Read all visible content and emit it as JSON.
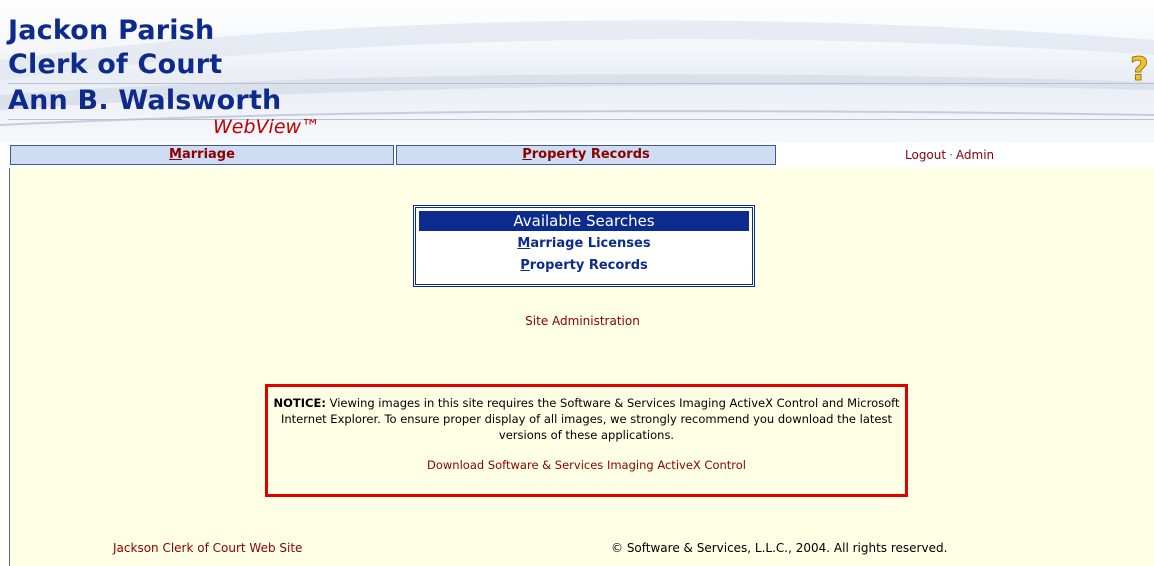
{
  "header": {
    "line1": "Jackon Parish",
    "line2": "Clerk of Court",
    "line3": "Ann B. Walsworth",
    "product": "WebView™",
    "help_icon": "question-mark-icon"
  },
  "nav": {
    "marriage_accesskey": "M",
    "marriage_rest": "arriage",
    "property_accesskey": "P",
    "property_rest": "roperty Records",
    "logout": "Logout",
    "separator": "·",
    "admin": "Admin"
  },
  "searches": {
    "title": "Available Searches",
    "marriage_accesskey": "M",
    "marriage_rest": "arriage Licenses",
    "property_accesskey": "P",
    "property_rest": "roperty Records"
  },
  "site_admin": "Site Administration",
  "notice": {
    "label": "NOTICE:",
    "text": "Viewing images in this site requires the Software & Services Imaging ActiveX Control and Microsoft Internet Explorer. To ensure proper display of all images, we strongly recommend you download the latest versions of these applications.",
    "download_link": "Download Software & Services Imaging ActiveX Control"
  },
  "footer": {
    "left_link": "Jackson Clerk of Court Web Site",
    "copyright": "© Software & Services, L.L.C., 2004. All rights reserved."
  },
  "colors": {
    "brand_blue": "#0d2b8c",
    "link_red": "#8b0000",
    "content_bg": "#ffffe6",
    "notice_border": "#e00000"
  }
}
